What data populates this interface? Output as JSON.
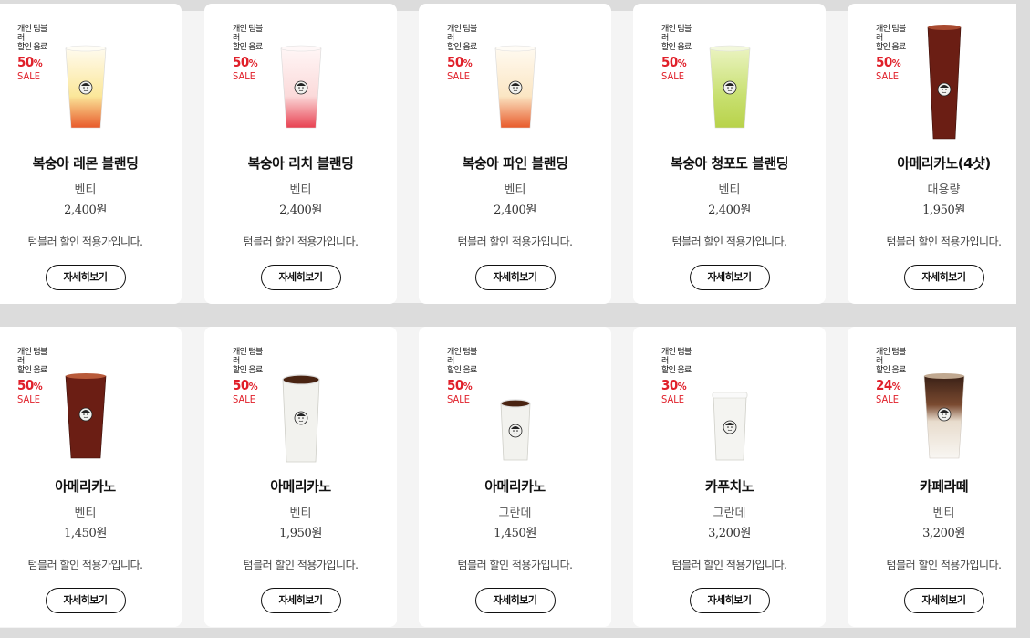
{
  "products": [
    {
      "badge_top": "개인 텀블러\n할인 음료",
      "discount": "50",
      "pct": "%",
      "sale": "SALE",
      "name": "복숭아 레몬 블랜딩",
      "size": "벤티",
      "price": "2,400원",
      "note": "텀블러 할인 적용가입니다.",
      "button": "자세히보기",
      "cup": "lemon"
    },
    {
      "badge_top": "개인 텀블러\n할인 음료",
      "discount": "50",
      "pct": "%",
      "sale": "SALE",
      "name": "복숭아 리치 블랜딩",
      "size": "벤티",
      "price": "2,400원",
      "note": "텀블러 할인 적용가입니다.",
      "button": "자세히보기",
      "cup": "lychee"
    },
    {
      "badge_top": "개인 텀블러\n할인 음료",
      "discount": "50",
      "pct": "%",
      "sale": "SALE",
      "name": "복숭아 파인 블랜딩",
      "size": "벤티",
      "price": "2,400원",
      "note": "텀블러 할인 적용가입니다.",
      "button": "자세히보기",
      "cup": "pine"
    },
    {
      "badge_top": "개인 텀블러\n할인 음료",
      "discount": "50",
      "pct": "%",
      "sale": "SALE",
      "name": "복숭아 청포도 블랜딩",
      "size": "벤티",
      "price": "2,400원",
      "note": "텀블러 할인 적용가입니다.",
      "button": "자세히보기",
      "cup": "grape"
    },
    {
      "badge_top": "개인 텀블러\n할인 음료",
      "discount": "50",
      "pct": "%",
      "sale": "SALE",
      "name": "아메리카노(4샷)",
      "size": "대용량",
      "price": "1,950원",
      "note": "텀블러 할인 적용가입니다.",
      "button": "자세히보기",
      "cup": "iced-tall"
    },
    {
      "badge_top": "개인 텀블러\n할인 음료",
      "discount": "50",
      "pct": "%",
      "sale": "SALE",
      "name": "아메리카노",
      "size": "벤티",
      "price": "1,450원",
      "note": "텀블러 할인 적용가입니다.",
      "button": "자세히보기",
      "cup": "iced"
    },
    {
      "badge_top": "개인 텀블러\n할인 음료",
      "discount": "50",
      "pct": "%",
      "sale": "SALE",
      "name": "아메리카노",
      "size": "벤티",
      "price": "1,950원",
      "note": "텀블러 할인 적용가입니다.",
      "button": "자세히보기",
      "cup": "hot-large"
    },
    {
      "badge_top": "개인 텀블러\n할인 음료",
      "discount": "50",
      "pct": "%",
      "sale": "SALE",
      "name": "아메리카노",
      "size": "그란데",
      "price": "1,450원",
      "note": "텀블러 할인 적용가입니다.",
      "button": "자세히보기",
      "cup": "hot-small"
    },
    {
      "badge_top": "개인 텀블러\n할인 음료",
      "discount": "30",
      "pct": "%",
      "sale": "SALE",
      "name": "카푸치노",
      "size": "그란데",
      "price": "3,200원",
      "note": "텀블러 할인 적용가입니다.",
      "button": "자세히보기",
      "cup": "hot-lid"
    },
    {
      "badge_top": "개인 텀블러\n할인 음료",
      "discount": "24",
      "pct": "%",
      "sale": "SALE",
      "name": "카페라떼",
      "size": "벤티",
      "price": "3,200원",
      "note": "텀블러 할인 적용가입니다.",
      "button": "자세히보기",
      "cup": "latte"
    }
  ]
}
